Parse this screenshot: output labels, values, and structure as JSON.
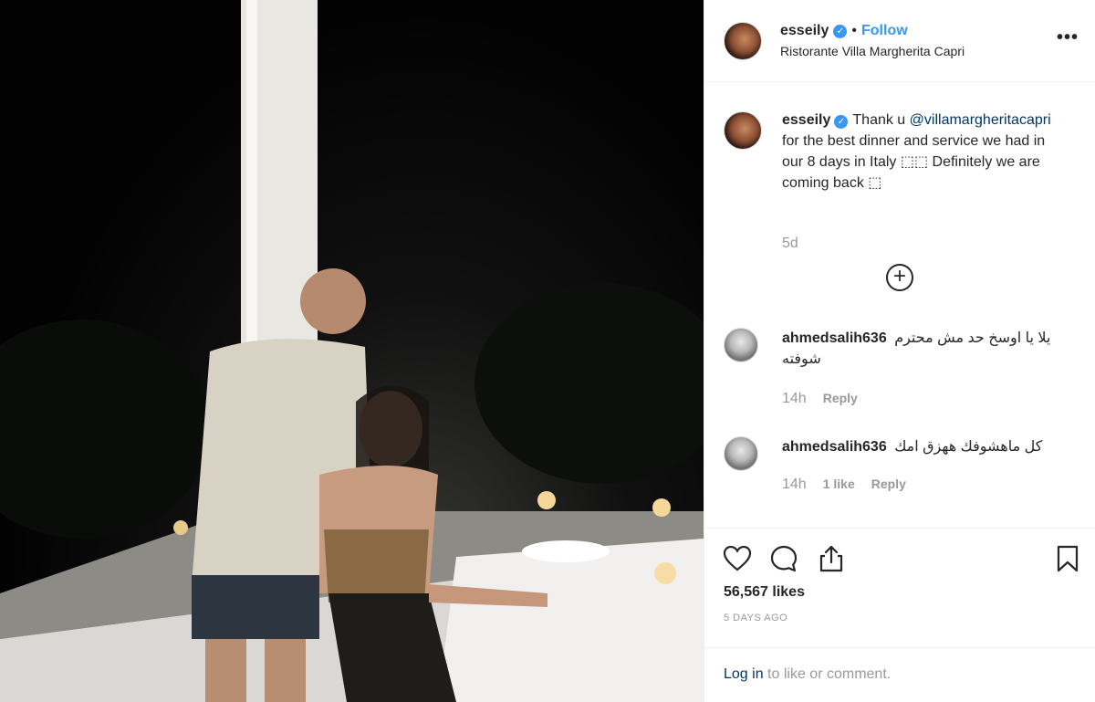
{
  "post": {
    "username": "esseily",
    "follow_label": "Follow",
    "separator": "•",
    "location": "Ristorante Villa Margherita Capri",
    "more_label": "•••"
  },
  "caption": {
    "username": "esseily",
    "text_start": "Thank u",
    "mention": "@villamargheritacapri",
    "text_end": "for the best dinner and service we had in our 8 days in Italy ⬚⬚ Definitely we are coming back ⬚",
    "time": "5d"
  },
  "comments": [
    {
      "username": "ahmedsalih636",
      "text": "يلا يا اوسخ حد مش محترم شوفته",
      "time": "14h",
      "likes": "",
      "reply_label": "Reply"
    },
    {
      "username": "ahmedsalih636",
      "text": "كل ماهشوفك ههزق امك",
      "time": "14h",
      "likes": "1 like",
      "reply_label": "Reply"
    }
  ],
  "actions": {
    "like_count": "56,567 likes",
    "posted": "5 DAYS AGO",
    "login_link": "Log in",
    "login_suffix": "to like or comment."
  },
  "icons": {
    "like": "heart-icon",
    "comment": "comment-icon",
    "share": "share-icon",
    "save": "bookmark-icon",
    "load_more": "plus-circle-icon",
    "verified": "verified-badge-icon"
  },
  "colors": {
    "link_blue": "#3897f0",
    "mention_navy": "#003569",
    "meta_gray": "#999999"
  }
}
